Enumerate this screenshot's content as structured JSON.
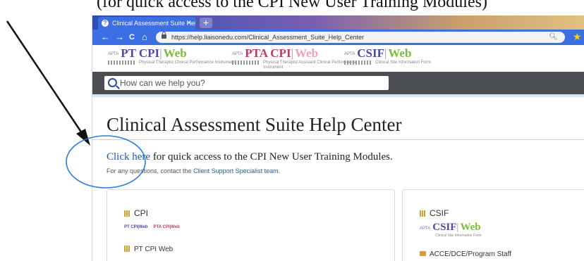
{
  "caption": "(for quick access to the CPI New User Training Modules)",
  "browser": {
    "tab_title": "Clinical Assessment Suite Help C",
    "tab_close": "×",
    "new_tab": "+",
    "back": "←",
    "forward": "→",
    "reload": "C",
    "home": "⌂",
    "url": "https://help.liaisonedu.com/Clinical_Assessment_Suite_Help_Center",
    "zoom_icon": "🔍︎",
    "star": "★"
  },
  "logos": {
    "apta": "APTA",
    "pt": {
      "name": "PT CPI",
      "sep": "|",
      "web": "Web",
      "sub": "Physical Therapist Clinical Performance Instrument"
    },
    "pta": {
      "name": "PTA CPI",
      "sep": "|",
      "web": "Web",
      "sub": "Physical Therapist Assistant Clinical Performance Instrument"
    },
    "csif": {
      "name": "CSIF",
      "sep": "|",
      "web": "Web",
      "sub": "Clinical Site Information Form"
    }
  },
  "search": {
    "placeholder": "How can we help you?"
  },
  "main": {
    "title": "Clinical Assessment Suite Help Center",
    "quick_link": "Click here",
    "quick_rest": " for quick access to the CPI New User Training Modules.",
    "contact_prefix": "For any questions, contact the ",
    "contact_link": "Client Support Specialist team",
    "contact_suffix": "."
  },
  "panels": {
    "cpi": {
      "title": "CPI",
      "mini_pt": "PT CPI|Web",
      "mini_pta": "PTA CPI|Web",
      "item": "PT CPI Web"
    },
    "csif": {
      "title": "CSIF",
      "item": "ACCE/DCE/Program Staff"
    }
  },
  "colors": {
    "browser_blue": "#3b6fe3",
    "search_bar": "#4b4e52",
    "annotation": "#2a7de1",
    "link": "#1a5db0"
  }
}
